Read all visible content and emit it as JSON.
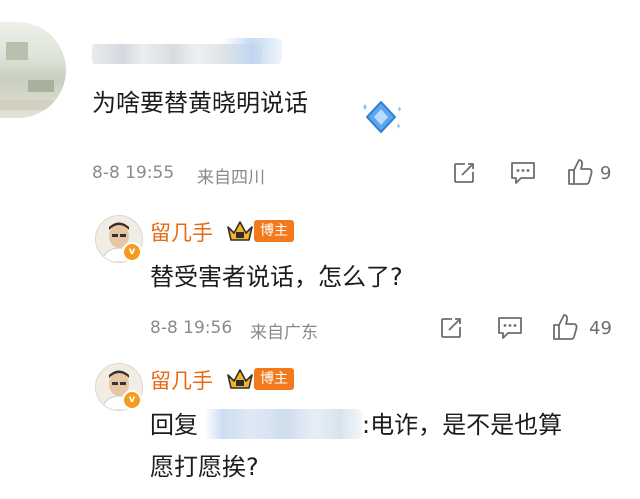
{
  "comment": {
    "text": "为啥要替黄晓明说话",
    "time": "8-8 19:55",
    "location": "来自四川",
    "likes": "9"
  },
  "replies": [
    {
      "author": "留几手",
      "badge": "博主",
      "text": "替受害者说话，怎么了?",
      "time": "8-8 19:56",
      "location": "来自广东",
      "likes": "49"
    },
    {
      "author": "留几手",
      "badge": "博主",
      "prefix": "回复",
      "suffix": ":电诈，是不是也算",
      "line2": "愿打愿挨?"
    }
  ],
  "icons": [
    "share-icon",
    "comment-icon",
    "like-icon",
    "crown-icon",
    "verified-v-icon",
    "diamond-emoji-icon"
  ],
  "colors": {
    "accent_orange": "#f27a1c",
    "nickname": "#e86a10",
    "meta_gray": "#8a8a8a",
    "text": "#1c1c1c"
  }
}
